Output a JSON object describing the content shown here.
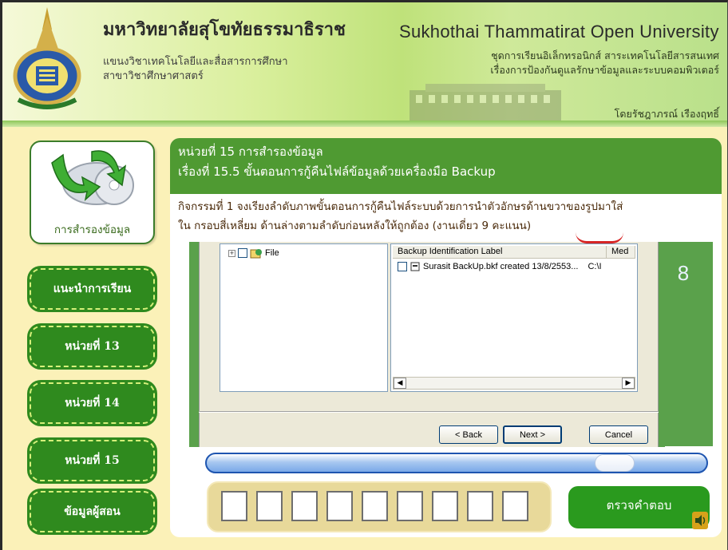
{
  "header": {
    "thai_title": "มหาวิทยาลัยสุโขทัยธรรมาธิราช",
    "thai_sub_line1": "แขนงวิชาเทคโนโลยีและสื่อสารการศึกษา",
    "thai_sub_line2": "สาขาวิชาศึกษาศาสตร์",
    "english_title": "Sukhothai Thammatirat Open University",
    "course_line1": "ชุดการเรียนอิเล็กทรอนิกส์ สาระเทคโนโลยีสารสนเทศ",
    "course_line2": "เรื่องการป้องกันดูแลรักษาข้อมูลและระบบคอมพิวเตอร์",
    "author": "โดยรัชฎาภรณ์ เรืองฤทธิ์"
  },
  "sidebar": {
    "topic_label": "การสำรองข้อมูล",
    "items": [
      {
        "label": "แนะนำการเรียน"
      },
      {
        "label": "หน่วยที่ 13"
      },
      {
        "label": "หน่วยที่ 14"
      },
      {
        "label": "หน่วยที่ 15"
      },
      {
        "label": "ข้อมูลผู้สอน"
      }
    ]
  },
  "main": {
    "unit_title": "หน่วยที่ 15 การสำรองข้อมูล",
    "lesson_title": "เรื่องที่ 15.5 ขั้นตอนการกู้คืนไฟล์ข้อมูลด้วยเครื่องมือ Backup",
    "instruction_line1": "กิจกรรมที่ 1 จงเรียงลำดับภาพขั้นตอนการกู้คืนไฟล์ระบบด้วยการนำตัวอักษรด้านขวาของรูปมาใส่",
    "instruction_line2": "ใน กรอบสี่เหลี่ยม ด้านล่างตามลำดับก่อนหลังให้ถูกต้อง (งานเดี่ยว 9 คะแนน)",
    "step_number": "8",
    "check_button": "ตรวจคำตอบ",
    "answer_boxes": [
      "",
      "",
      "",
      "",
      "",
      "",
      "",
      "",
      ""
    ]
  },
  "dialog": {
    "tree_item": "File",
    "col_label": "Backup Identification Label",
    "col_media": "Med",
    "row_label": "Surasit BackUp.bkf created 13/8/2553...",
    "row_media": "C:\\I",
    "back_button": "< Back",
    "next_button": "Next >",
    "cancel_button": "Cancel"
  },
  "colors": {
    "accent_green": "#2f8a1e",
    "header_green": "#4f9a32",
    "background_yellow": "#fbf1b8"
  }
}
